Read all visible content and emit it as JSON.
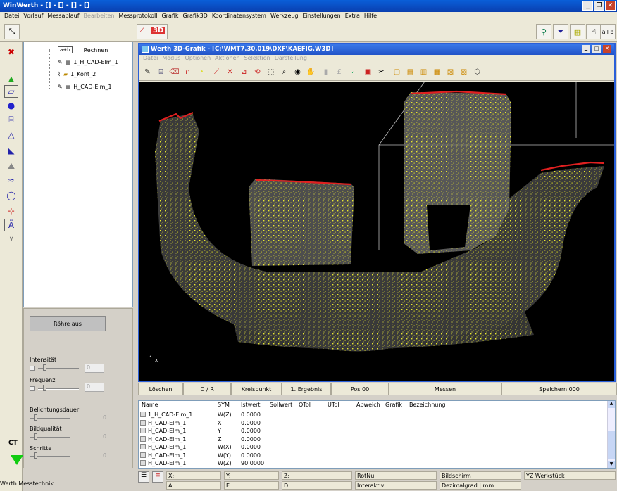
{
  "app": {
    "title": "WinWerth - [] - [] - [] - []"
  },
  "menu": [
    "Datei",
    "Vorlauf",
    "Messablauf",
    "Bearbeiten",
    "Messprotokoll",
    "Grafik",
    "Grafik3D",
    "Koordinatensystem",
    "Werkzeug",
    "Einstellungen",
    "Extra",
    "Hilfe"
  ],
  "menu_disabled_index": 3,
  "toolbar": {
    "label_3d": "3D",
    "label_ab": "a+b"
  },
  "tree": {
    "items": [
      {
        "icon": "a+b",
        "label": "Rechnen"
      },
      {
        "label": "1_H_CAD-Elm_1"
      },
      {
        "label": "1_Kont_2"
      },
      {
        "label": "H_CAD-Elm_1"
      }
    ]
  },
  "control": {
    "roehre_label": "Röhre aus",
    "intensitaet_label": "Intensität",
    "intensitaet_value": "0",
    "frequenz_label": "Frequenz",
    "frequenz_value": "0",
    "belichtung_label": "Belichtungsdauer",
    "belichtung_value": "0",
    "bildqualitaet_label": "Bildqualität",
    "bildqualitaet_value": "0",
    "schritte_label": "Schritte",
    "schritte_value": "0",
    "ct_label": "CT"
  },
  "inner_window": {
    "title": "Werth 3D-Grafik - [C:\\WMT7.30.019\\DXF\\KAEFIG.W3D]",
    "menu": [
      "Datei",
      "Modus",
      "Optionen",
      "Aktionen",
      "Selektion",
      "Darstellung"
    ],
    "axis_z": "z",
    "axis_x": "x"
  },
  "buttons": [
    "Löschen",
    "D / R",
    "Kreispunkt",
    "1. Ergebnis",
    "Pos 00",
    "Messen",
    "Speichern 000"
  ],
  "table": {
    "headers": [
      "Name",
      "SYM",
      "Istwert",
      "Sollwert",
      "OTol",
      "UTol",
      "Abweich",
      "Grafik",
      "Bezeichnung"
    ],
    "rows": [
      {
        "name": "1_H_CAD-Elm_1",
        "sym": "W(Z)",
        "ist": "0.0000"
      },
      {
        "name": "H_CAD-Elm_1",
        "sym": "X",
        "ist": "0.0000"
      },
      {
        "name": "H_CAD-Elm_1",
        "sym": "Y",
        "ist": "0.0000"
      },
      {
        "name": "H_CAD-Elm_1",
        "sym": "Z",
        "ist": "0.0000"
      },
      {
        "name": "H_CAD-Elm_1",
        "sym": "W(X)",
        "ist": "0.0000"
      },
      {
        "name": "H_CAD-Elm_1",
        "sym": "W(Y)",
        "ist": "0.0000"
      },
      {
        "name": "H_CAD-Elm_1",
        "sym": "W(Z)",
        "ist": "90.0000"
      }
    ]
  },
  "status": {
    "x": "X:",
    "y": "Y:",
    "z": "Z:",
    "a": "A:",
    "e": "E:",
    "d": "D:",
    "rotnul": "RotNul",
    "bildschirm": "Bildschirm",
    "werkstueck": "YZ Werkstück",
    "interaktiv": "Interaktiv",
    "einheit": "Dezimalgrad | mm"
  },
  "footer": "Werth Messtechnik",
  "colors": {
    "point_cloud": "#e8e830",
    "edges": "#e02020",
    "title_blue": "#0a3fb0"
  }
}
